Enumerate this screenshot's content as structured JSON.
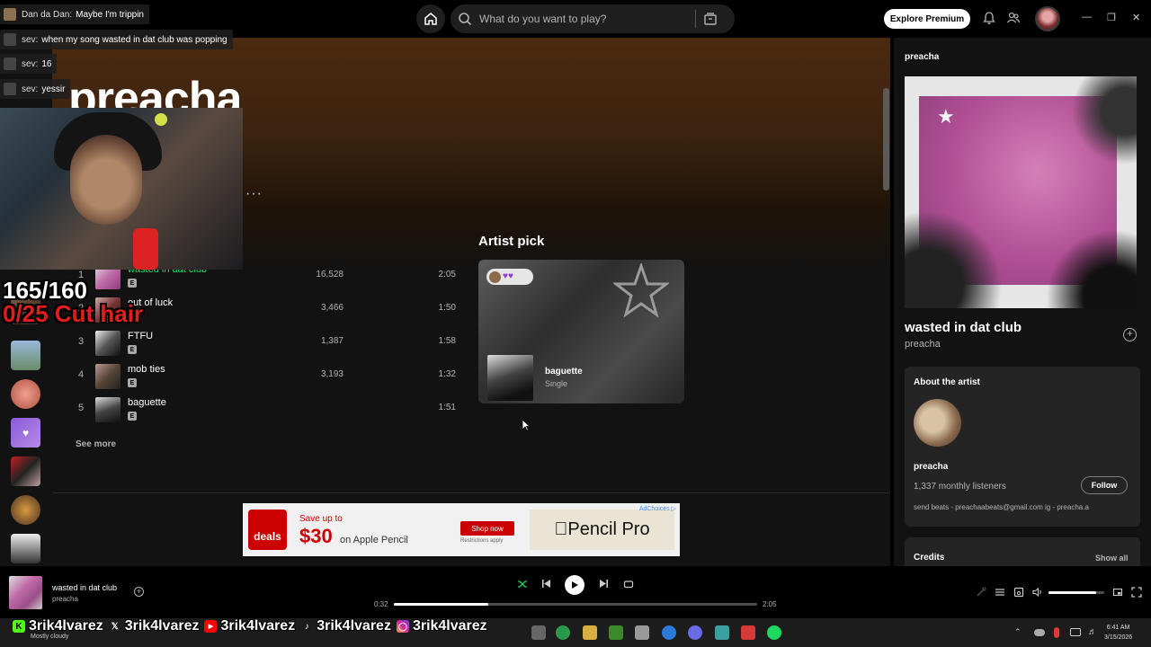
{
  "topbar": {
    "search_placeholder": "What do you want to play?",
    "premium_label": "Explore Premium",
    "icons": [
      "home-icon",
      "search-icon",
      "browse-icon",
      "bell-icon",
      "friends-icon"
    ]
  },
  "artist": {
    "name": "preacha",
    "more": "···"
  },
  "popular_tracks": [
    {
      "num": "1",
      "title": "wasted in dat club",
      "explicit": "E",
      "plays": "16,528",
      "duration": "2:05",
      "playing": true
    },
    {
      "num": "2",
      "title": "out of luck",
      "explicit": "E",
      "plays": "3,466",
      "duration": "1:50"
    },
    {
      "num": "3",
      "title": "FTFU",
      "explicit": "E",
      "plays": "1,387",
      "duration": "1:58"
    },
    {
      "num": "4",
      "title": "mob ties",
      "explicit": "E",
      "plays": "3,193",
      "duration": "1:32"
    },
    {
      "num": "5",
      "title": "baguette",
      "explicit": "E",
      "plays": "",
      "duration": "1:51"
    }
  ],
  "see_more": "See more",
  "artist_pick": {
    "heading": "Artist pick",
    "badge": "♥♥",
    "title": "baguette",
    "subtitle": "Single"
  },
  "ad": {
    "deals": "deals",
    "save": "Save up to",
    "price": "$30",
    "product": "on Apple Pencil",
    "shop": "Shop now",
    "restrictions": "Restrictions apply",
    "brand": "Pencil Pro",
    "info": "AdChoices ▷"
  },
  "right_panel": {
    "title": "preacha",
    "song": "wasted in dat club",
    "artist": "preacha",
    "about_heading": "About the artist",
    "about_name": "preacha",
    "listeners": "1,337 monthly listeners",
    "follow": "Follow",
    "bio": "send beats - preachaabeats@gmail.com ig - preacha.a",
    "credits": "Credits",
    "show_all": "Show all"
  },
  "player": {
    "title": "wasted in dat club",
    "artist": "preacha",
    "elapsed": "0:32",
    "total": "2:05",
    "progress": 0.26,
    "volume": 0.85
  },
  "taskbar": {
    "weather": "Mostly cloudy",
    "time": "6:41 AM",
    "date": "3/15/2026"
  },
  "overlay": {
    "chat": [
      {
        "name": "Dan da Dan:",
        "msg": "Maybe I'm trippin"
      },
      {
        "name": "sev:",
        "msg": "when my song wasted in dat club was popping"
      },
      {
        "name": "sev:",
        "msg": "16"
      },
      {
        "name": "sev:",
        "msg": "yessir"
      }
    ],
    "counter": "165/160",
    "goal": "0/25 Cut hair",
    "socials": [
      {
        "platform": "kick",
        "handle": "3rik4lvarez"
      },
      {
        "platform": "x",
        "handle": "3rik4lvarez"
      },
      {
        "platform": "youtube",
        "handle": "3rik4lvarez"
      },
      {
        "platform": "tiktok",
        "handle": "3rik4lvarez"
      },
      {
        "platform": "instagram",
        "handle": "3rik4lvarez"
      }
    ]
  },
  "colors": {
    "accent": "#1ed760",
    "hero_top": "#4a2a10",
    "background": "#121212",
    "goal_red": "#e21d1d"
  }
}
